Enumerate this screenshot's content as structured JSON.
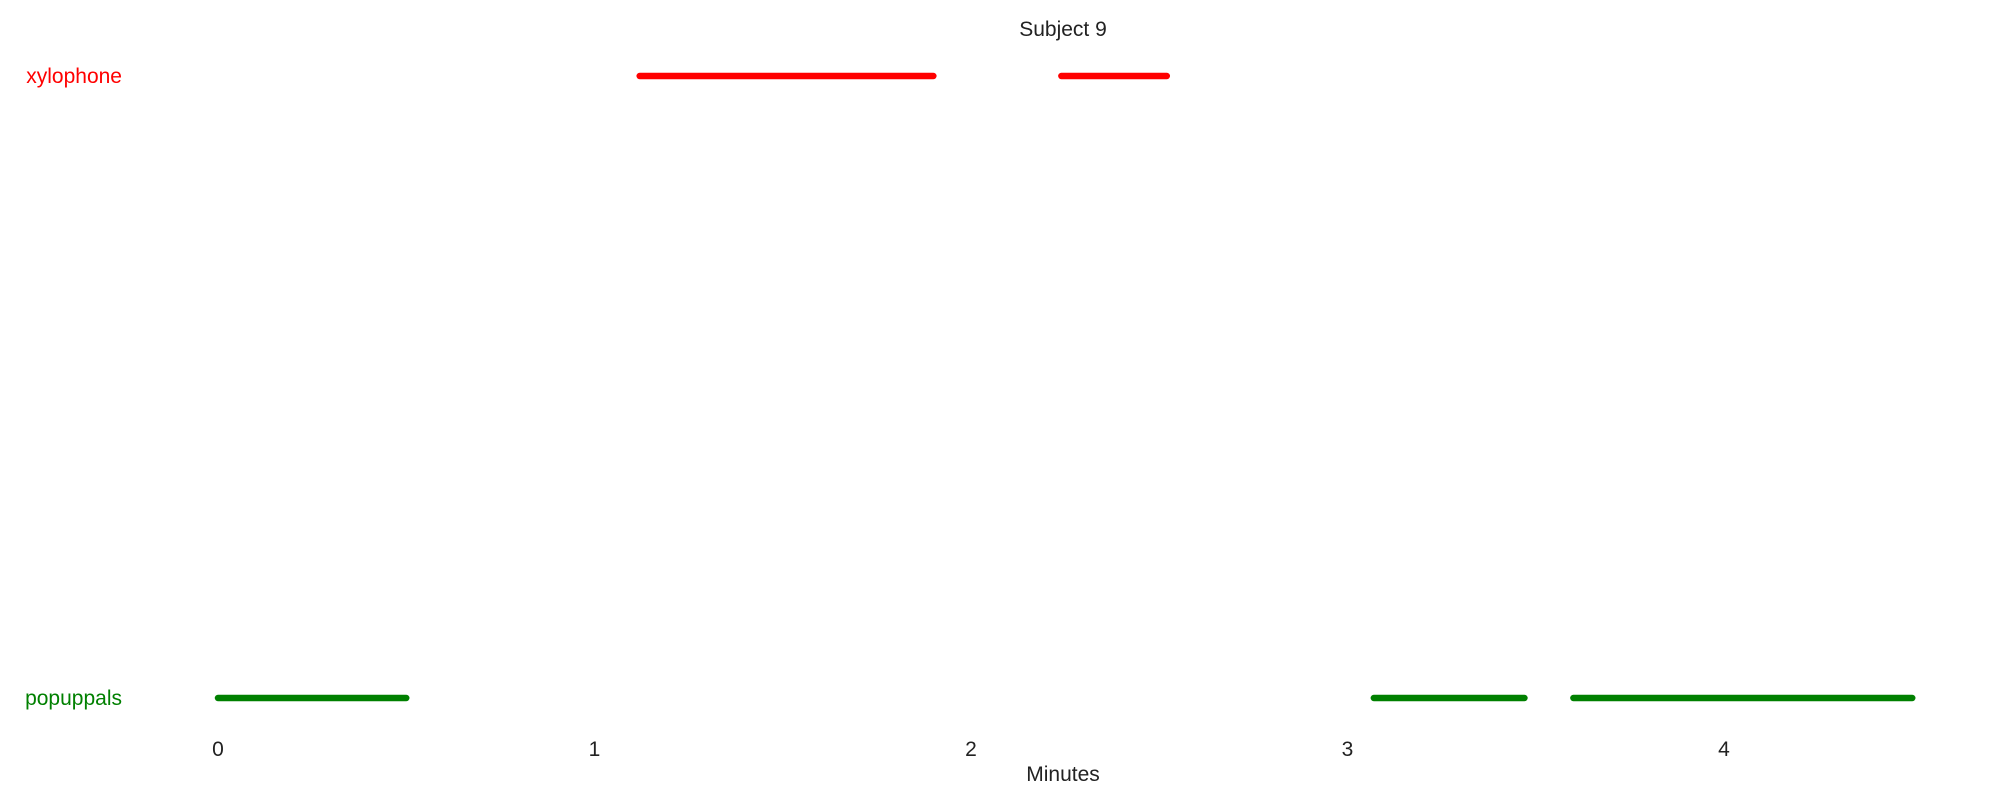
{
  "chart_data": {
    "type": "timeline",
    "title": "Subject 9",
    "xlabel": "Minutes",
    "ylabel": "",
    "xlim": [
      0,
      4.5
    ],
    "x_ticks": [
      0,
      1,
      2,
      3,
      4
    ],
    "grid": false,
    "series": [
      {
        "name": "xylophone",
        "color": "#ff0000",
        "intervals": [
          [
            1.12,
            1.9
          ],
          [
            2.24,
            2.52
          ]
        ]
      },
      {
        "name": "popuppals",
        "color": "#008000",
        "intervals": [
          [
            0.0,
            0.5
          ],
          [
            3.07,
            3.47
          ],
          [
            3.6,
            4.5
          ]
        ]
      }
    ]
  }
}
